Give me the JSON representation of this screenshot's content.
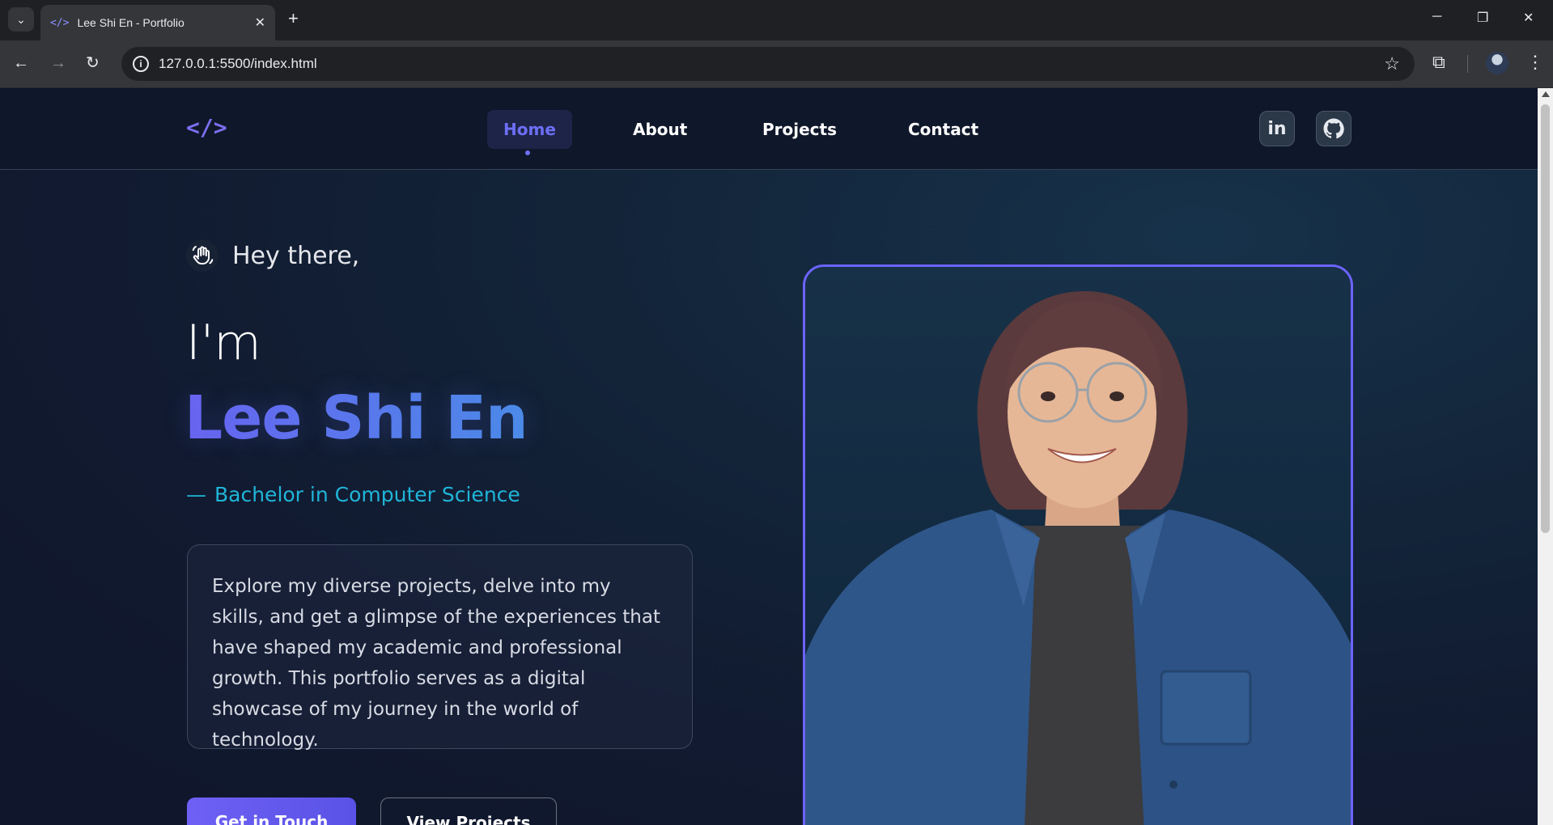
{
  "browser": {
    "tab_title": "Lee Shi En - Portfolio",
    "tab_favicon": "</>",
    "url": "127.0.0.1:5500/index.html"
  },
  "site": {
    "logo": "</>",
    "nav": [
      {
        "label": "Home",
        "active": true
      },
      {
        "label": "About",
        "active": false
      },
      {
        "label": "Projects",
        "active": false
      },
      {
        "label": "Contact",
        "active": false
      }
    ],
    "social": {
      "linkedin": "in",
      "github": "github-icon"
    }
  },
  "hero": {
    "greeting": "Hey there,",
    "im": "I'm",
    "name": "Lee Shi En",
    "degree": "Bachelor in Computer Science",
    "degree_dash": "—",
    "intro": "Explore my diverse projects, delve into my skills, and get a glimpse of the experiences that have shaped my academic and professional growth. This portfolio serves as a digital showcase of my journey in the world of technology.",
    "primary_button": "Get in Touch",
    "secondary_button": "View Projects"
  },
  "colors": {
    "accent": "#6c63ff",
    "name_gradient_start": "#6a64f1",
    "name_gradient_end": "#4b8ee8",
    "degree": "#20b5d8",
    "header_bg": "#0f172a"
  }
}
